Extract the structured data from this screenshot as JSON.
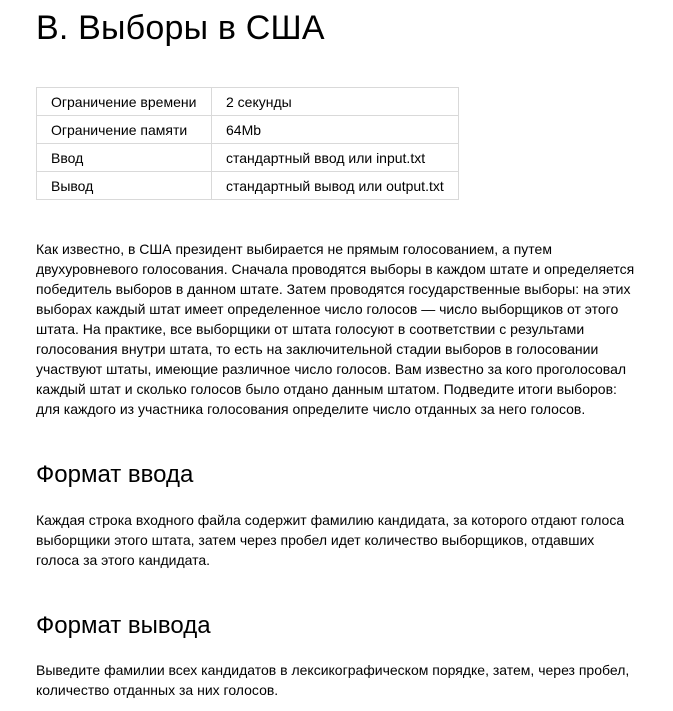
{
  "problem": {
    "title": "B. Выборы в США"
  },
  "limits": {
    "rows": [
      {
        "label": "Ограничение времени",
        "value": "2 секунды"
      },
      {
        "label": "Ограничение памяти",
        "value": "64Mb"
      },
      {
        "label": "Ввод",
        "value": "стандартный ввод или input.txt"
      },
      {
        "label": "Вывод",
        "value": "стандартный вывод или output.txt"
      }
    ]
  },
  "statement": {
    "text": "Как известно, в США президент выбирается не прямым голосованием, а путем двухуровневого голосования. Сначала проводятся выборы в каждом штате и определяется победитель выборов в данном штате. Затем проводятся государственные выборы: на этих выборах каждый штат имеет определенное число голосов — число выборщиков от этого штата. На практике, все выборщики от штата голосуют в соответствии с результами голосования внутри штата, то есть на заключительной стадии выборов в голосовании участвуют штаты, имеющие различное число голосов. Вам известно за кого проголосовал каждый штат и сколько голосов было отдано данным штатом. Подведите итоги выборов: для каждого из участника голосования определите число отданных за него голосов."
  },
  "input_format": {
    "heading": "Формат ввода",
    "text": "Каждая строка входного файла содержит фамилию кандидата, за которого отдают голоса выборщики этого штата, затем через пробел идет количество выборщиков, отдавших голоса за этого кандидата."
  },
  "output_format": {
    "heading": "Формат вывода",
    "text": "Выведите фамилии всех кандидатов в лексикографическом порядке, затем, через пробел, количество отданных за них голосов."
  }
}
